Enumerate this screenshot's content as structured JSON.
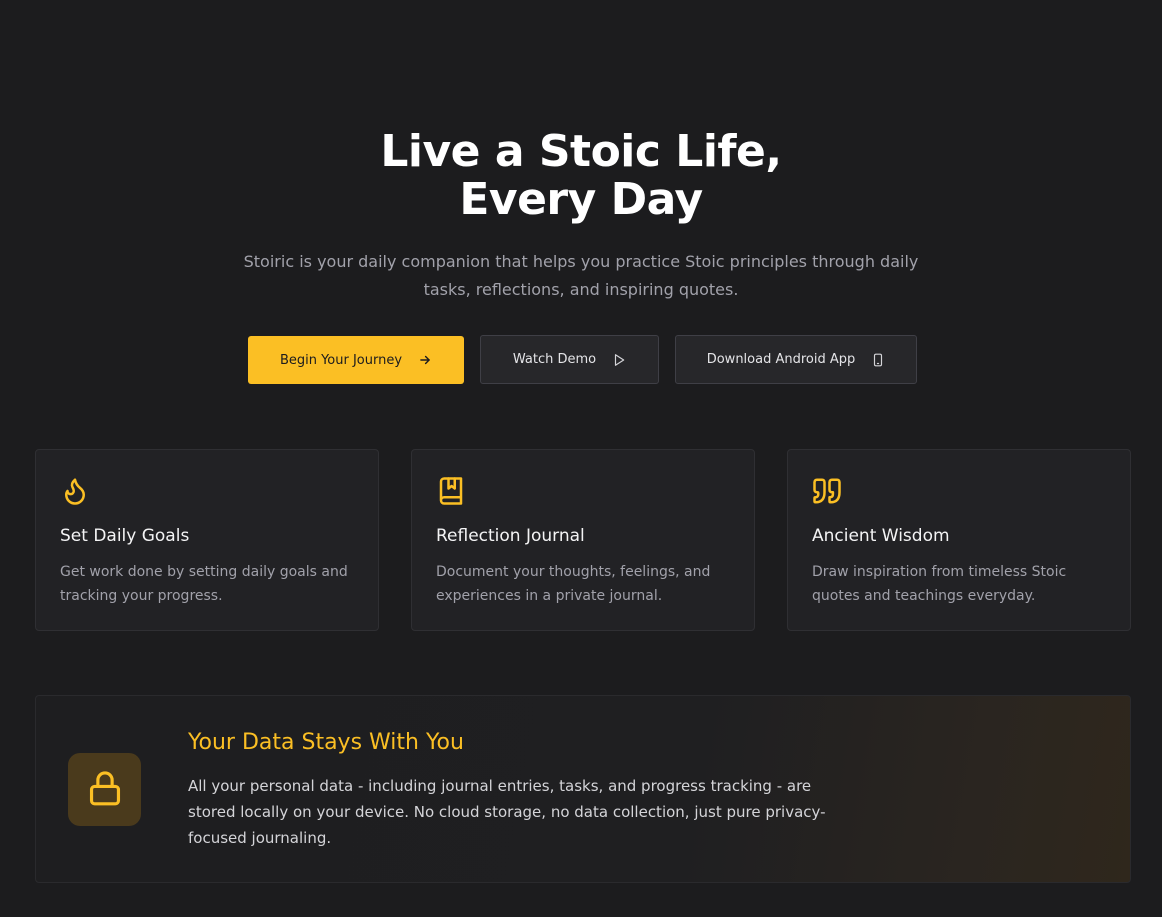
{
  "hero": {
    "title_line1": "Live a Stoic Life,",
    "title_line2": "Every Day",
    "subtitle": "Stoiric is your daily companion that helps you practice Stoic principles through daily tasks, reflections, and inspiring quotes."
  },
  "buttons": {
    "begin": "Begin Your Journey",
    "demo": "Watch Demo",
    "android": "Download Android App"
  },
  "features": [
    {
      "icon": "flame-icon",
      "title": "Set Daily Goals",
      "description": "Get work done by setting daily goals and tracking your progress."
    },
    {
      "icon": "book-bookmark-icon",
      "title": "Reflection Journal",
      "description": "Document your thoughts, feelings, and experiences in a private journal."
    },
    {
      "icon": "quote-icon",
      "title": "Ancient Wisdom",
      "description": "Draw inspiration from timeless Stoic quotes and teachings everyday."
    }
  ],
  "privacy": {
    "icon": "lock-icon",
    "title": "Your Data Stays With You",
    "description": "All your personal data - including journal entries, tasks, and progress tracking - are stored locally on your device. No cloud storage, no data collection, just pure privacy-focused journaling."
  },
  "colors": {
    "background": "#1c1c1e",
    "accent": "#fbbf24",
    "card": "#222225",
    "muted_text": "#a1a1aa"
  }
}
